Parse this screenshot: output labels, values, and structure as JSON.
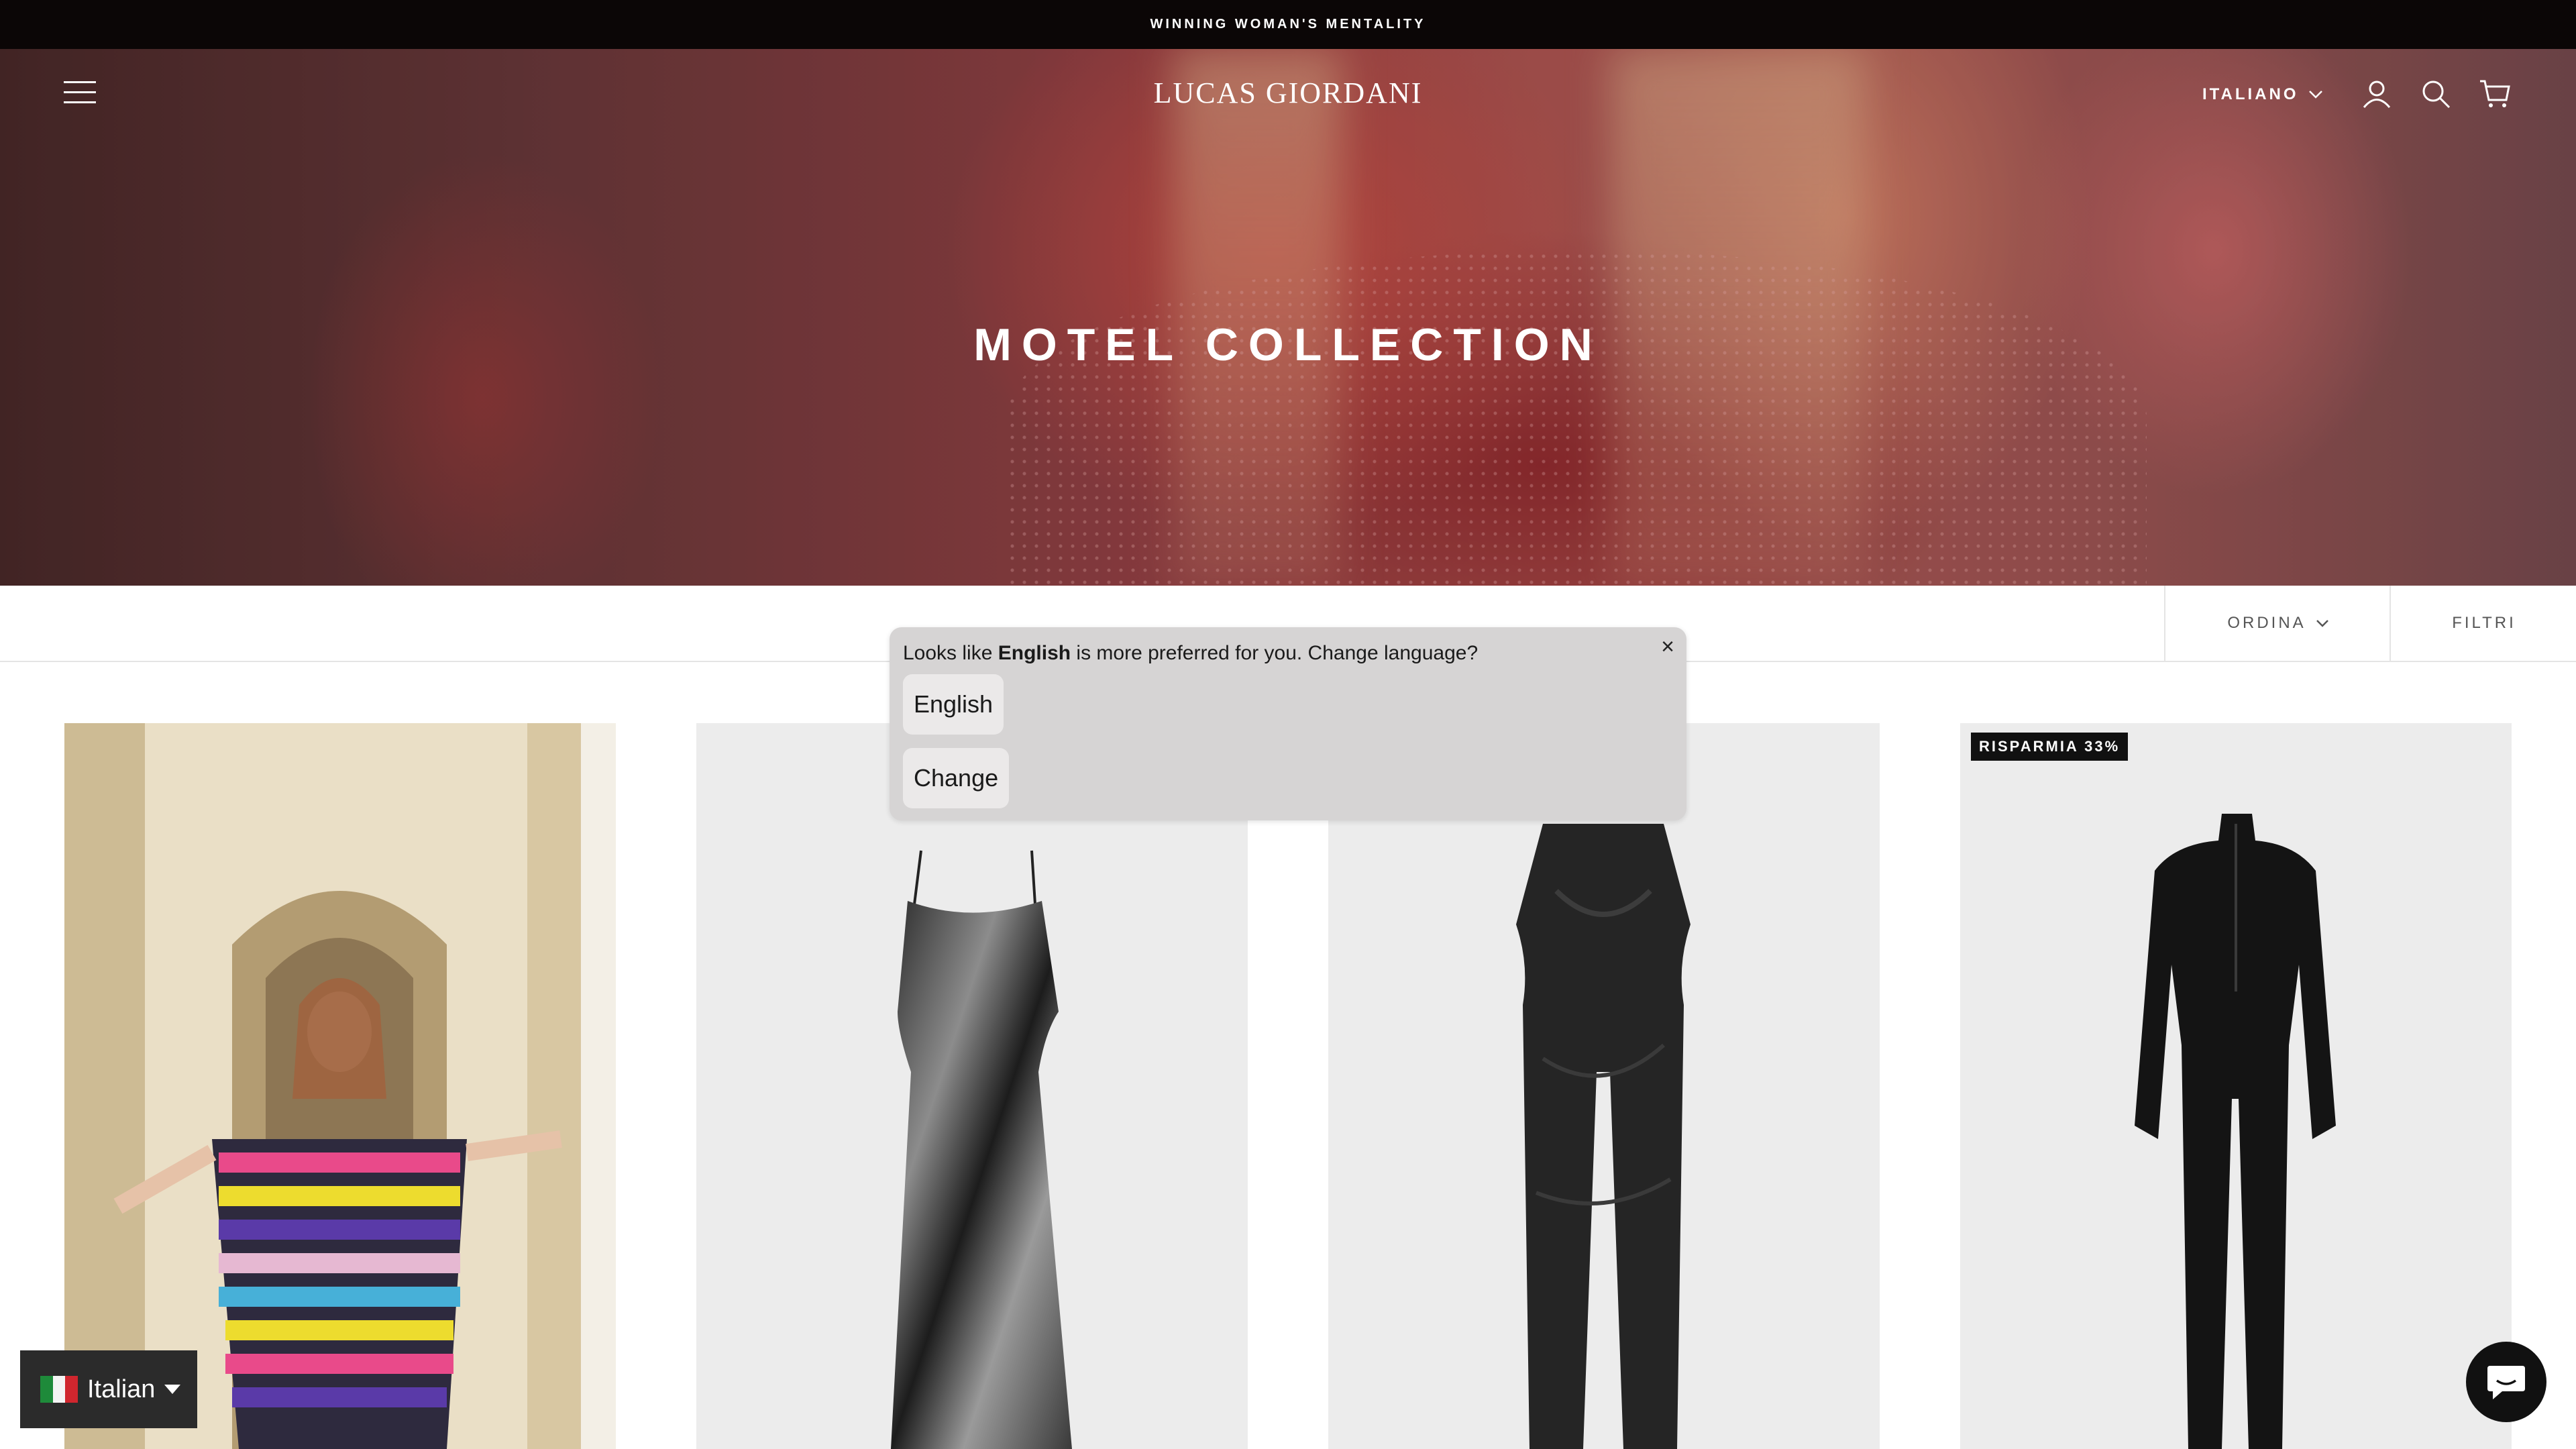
{
  "announcement": {
    "text": "WINNING WOMAN'S MENTALITY"
  },
  "header": {
    "logo": "LUCAS GIORDANI",
    "language_label": "ITALIANO"
  },
  "hero": {
    "title": "MOTEL COLLECTION"
  },
  "toolbar": {
    "sort_label": "ORDINA",
    "filter_label": "FILTRI"
  },
  "products": [
    {
      "badge": ""
    },
    {
      "badge": ""
    },
    {
      "badge": ""
    },
    {
      "badge": "RISPARMIA 33%"
    }
  ],
  "language_popup": {
    "text_prefix": "Looks like ",
    "language": "English",
    "text_suffix": " is more preferred for you. Change language?",
    "close": "×",
    "option_button": "English",
    "change_button": "Change"
  },
  "language_switcher": {
    "label": "Italian"
  },
  "colors": {
    "announcement_bg": "#0b0606",
    "product_bg": "#ececec",
    "popup_bg": "#d6d4d4",
    "switcher_bg": "#2b2b2b"
  }
}
